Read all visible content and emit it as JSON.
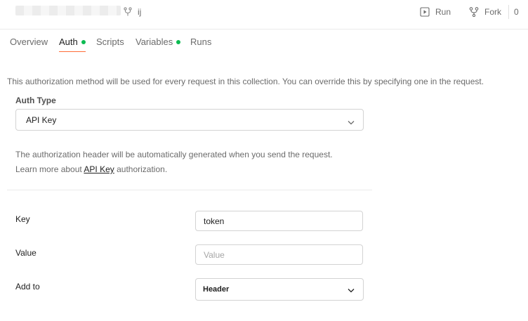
{
  "header": {
    "environment_label": "ij",
    "run_label": "Run",
    "fork_label": "Fork",
    "fork_count": "0"
  },
  "tabs": [
    {
      "label": "Overview",
      "active": false,
      "has_dot": false
    },
    {
      "label": "Auth",
      "active": true,
      "has_dot": true
    },
    {
      "label": "Scripts",
      "active": false,
      "has_dot": false
    },
    {
      "label": "Variables",
      "active": false,
      "has_dot": true
    },
    {
      "label": "Runs",
      "active": false,
      "has_dot": false
    }
  ],
  "auth": {
    "description": "This authorization method will be used for every request in this collection. You can override this by specifying one in the request.",
    "type_label": "Auth Type",
    "type_value": "API Key",
    "info_line1": "The authorization header will be automatically generated when you send the request.",
    "info_line2_prefix": "Learn more about ",
    "info_link": "API Key",
    "info_line2_suffix": " authorization.",
    "key_label": "Key",
    "key_value": "token",
    "value_label": "Value",
    "value_placeholder": "Value",
    "value_value": "",
    "addto_label": "Add to",
    "addto_value": "Header"
  },
  "colors": {
    "accent_orange": "#ff6c37",
    "status_green": "#0cbb52"
  }
}
